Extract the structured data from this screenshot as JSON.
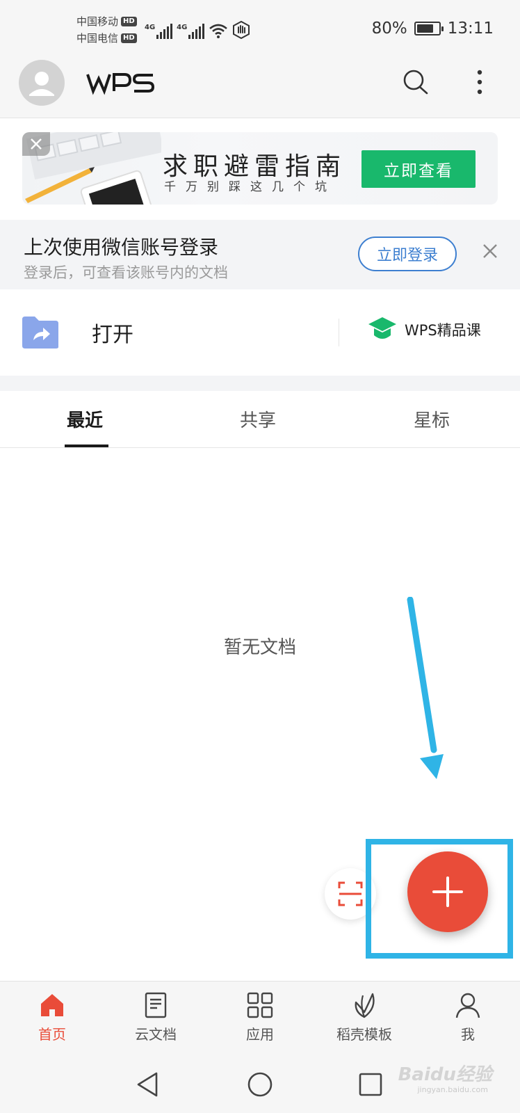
{
  "status_bar": {
    "carrier_1": "中国移动",
    "carrier_2": "中国电信",
    "hd_badge": "HD",
    "network_type": "4G",
    "battery": "80%",
    "battery_level": 0.8,
    "time": "13:11"
  },
  "header": {
    "logo_text": "WPS",
    "search_icon": "search-icon",
    "more_icon": "more-vertical-icon"
  },
  "banner": {
    "title": "求职避雷指南",
    "subtitle": "千万别踩这几个坑",
    "cta_label": "立即查看"
  },
  "login_prompt": {
    "title": "上次使用微信账号登录",
    "subtitle": "登录后，可查看该账号内的文档",
    "button_label": "立即登录"
  },
  "quick_actions": {
    "open_label": "打开",
    "course_label": "WPS精品课"
  },
  "tabs": [
    {
      "label": "最近",
      "active": true
    },
    {
      "label": "共享",
      "active": false
    },
    {
      "label": "星标",
      "active": false
    }
  ],
  "empty_state": {
    "text": "暂无文档"
  },
  "fab": {
    "icon": "plus-icon",
    "color": "#e94c39"
  },
  "bottom_nav": [
    {
      "label": "首页",
      "icon": "home-icon",
      "active": true
    },
    {
      "label": "云文档",
      "icon": "cloud-doc-icon",
      "active": false
    },
    {
      "label": "应用",
      "icon": "apps-grid-icon",
      "active": false
    },
    {
      "label": "稻壳模板",
      "icon": "leaf-icon",
      "active": false
    },
    {
      "label": "我",
      "icon": "user-icon",
      "active": false
    }
  ],
  "watermark": {
    "text": "Baidu经验",
    "url_text": "jingyan.baidu.com"
  },
  "colors": {
    "accent": "#e94c39",
    "banner_button": "#19b86c",
    "login_button": "#3d7fd0",
    "annotation": "#2fb4e6"
  }
}
